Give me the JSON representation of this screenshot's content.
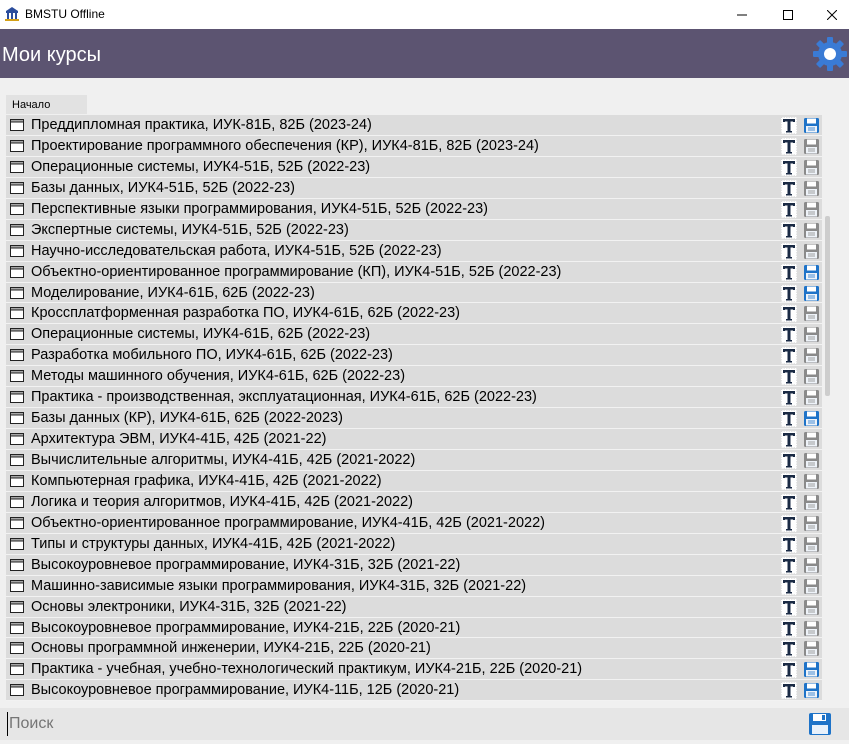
{
  "window": {
    "title": "BMSTU Offline"
  },
  "header": {
    "title": "Мои курсы"
  },
  "breadcrumb": {
    "label": "Начало"
  },
  "colors": {
    "header_bg": "#5c5471",
    "gear": "#3a7bd5",
    "row_bg": "#dcdcdc",
    "save_active": "#1e73c8",
    "save_inactive": "#8a8a8a"
  },
  "courses": [
    {
      "title": "Преддипломная практика, ИУК-81Б, 82Б (2023-24)",
      "saved": true
    },
    {
      "title": "Проектирование программного обеспечения (КР), ИУК4-81Б, 82Б (2023-24)",
      "saved": false
    },
    {
      "title": "Операционные системы, ИУК4-51Б, 52Б (2022-23)",
      "saved": false
    },
    {
      "title": "Базы данных, ИУК4-51Б, 52Б (2022-23)",
      "saved": false
    },
    {
      "title": "Перспективные языки программирования, ИУК4-51Б, 52Б (2022-23)",
      "saved": false
    },
    {
      "title": "Экспертные системы, ИУК4-51Б, 52Б (2022-23)",
      "saved": false
    },
    {
      "title": "Научно-исследовательская работа, ИУК4-51Б, 52Б (2022-23)",
      "saved": false
    },
    {
      "title": "Объектно-ориентированное программирование (КП), ИУК4-51Б, 52Б (2022-23)",
      "saved": true
    },
    {
      "title": "Моделирование, ИУК4-61Б, 62Б (2022-23)",
      "saved": true
    },
    {
      "title": "Кроссплатформенная разработка ПО, ИУК4-61Б, 62Б (2022-23)",
      "saved": false
    },
    {
      "title": "Операционные системы, ИУК4-61Б, 62Б (2022-23)",
      "saved": false
    },
    {
      "title": "Разработка мобильного ПО, ИУК4-61Б, 62Б (2022-23)",
      "saved": false
    },
    {
      "title": "Методы машинного обучения, ИУК4-61Б, 62Б (2022-23)",
      "saved": false
    },
    {
      "title": "Практика - производственная, эксплуатационная, ИУК4-61Б, 62Б (2022-23)",
      "saved": false
    },
    {
      "title": "Базы данных (КР), ИУК4-61Б, 62Б (2022-2023)",
      "saved": true
    },
    {
      "title": "Архитектура ЭВМ, ИУК4-41Б, 42Б (2021-22)",
      "saved": false
    },
    {
      "title": "Вычислительные алгоритмы, ИУК4-41Б, 42Б (2021-2022)",
      "saved": false
    },
    {
      "title": "Компьютерная графика, ИУК4-41Б, 42Б (2021-2022)",
      "saved": false
    },
    {
      "title": "Логика и теория алгоритмов, ИУК4-41Б, 42Б (2021-2022)",
      "saved": false
    },
    {
      "title": "Объектно-ориентированное программирование, ИУК4-41Б, 42Б (2021-2022)",
      "saved": false
    },
    {
      "title": "Типы и структуры данных, ИУК4-41Б, 42Б (2021-2022)",
      "saved": false
    },
    {
      "title": "Высокоуровневое программирование, ИУК4-31Б, 32Б (2021-22)",
      "saved": false
    },
    {
      "title": "Машинно-зависимые языки программирования, ИУК4-31Б, 32Б (2021-22)",
      "saved": false
    },
    {
      "title": "Основы электроники, ИУК4-31Б, 32Б (2021-22)",
      "saved": false
    },
    {
      "title": "Высокоуровневое программирование, ИУК4-21Б, 22Б (2020-21)",
      "saved": false
    },
    {
      "title": "Основы программной инженерии, ИУК4-21Б, 22Б (2020-21)",
      "saved": false
    },
    {
      "title": "Практика - учебная, учебно-технологический практикум, ИУК4-21Б, 22Б (2020-21)",
      "saved": true
    },
    {
      "title": "Высокоуровневое программирование, ИУК4-11Б, 12Б (2020-21)",
      "saved": true
    }
  ],
  "search": {
    "placeholder": "Поиск",
    "value": ""
  },
  "icons": {
    "row_type": "document-icon",
    "text_action": "text-t-icon",
    "save_action": "floppy-save-icon",
    "settings": "gear-icon"
  }
}
